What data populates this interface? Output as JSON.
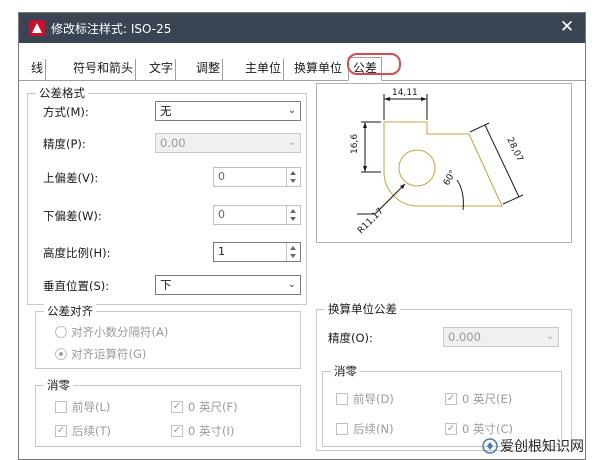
{
  "window": {
    "title": "修改标注样式: ISO-25",
    "close_glyph": "✕"
  },
  "tabs": [
    {
      "label": "线"
    },
    {
      "label": "符号和箭头"
    },
    {
      "label": "文字"
    },
    {
      "label": "调整"
    },
    {
      "label": "主单位"
    },
    {
      "label": "换算单位"
    },
    {
      "label": "公差",
      "active": true
    }
  ],
  "tolerance_format": {
    "title": "公差格式",
    "method": {
      "label": "方式(M):",
      "value": "无"
    },
    "precision": {
      "label": "精度(P):",
      "value": "0.00"
    },
    "upper": {
      "label": "上偏差(V):",
      "value": "0"
    },
    "lower": {
      "label": "下偏差(W):",
      "value": "0"
    },
    "height_scale": {
      "label": "高度比例(H):",
      "value": "1"
    },
    "vertical_position": {
      "label": "垂直位置(S):",
      "value": "下"
    }
  },
  "tolerance_align": {
    "title": "公差对齐",
    "opt1": "对齐小数分隔符(A)",
    "opt2": "对齐运算符(G)"
  },
  "zero_suppress_left": {
    "title": "消零",
    "leading": "前导(L)",
    "trailing": "后续(T)",
    "feet": "0 英尺(F)",
    "inches": "0 英寸(I)"
  },
  "alt_tolerance": {
    "title": "换算单位公差",
    "precision": {
      "label": "精度(O):",
      "value": "0.000"
    }
  },
  "zero_suppress_right": {
    "title": "消零",
    "leading": "前导(D)",
    "trailing": "后续(N)",
    "feet": "0 英尺(E)",
    "inches": "0 英寸(C)"
  },
  "preview": {
    "dim_top": "14,11",
    "dim_left": "16,6",
    "dim_right": "28,07",
    "dim_angle": "60°",
    "dim_radius": "R11,17"
  },
  "watermark": {
    "text": "爱创根知识网"
  },
  "colors": {
    "titlebar": "#3b4453",
    "highlight": "#d94a4a",
    "outline": "#c8a040"
  },
  "icons": {
    "app": "autocad-logo-icon",
    "close": "close-icon"
  }
}
